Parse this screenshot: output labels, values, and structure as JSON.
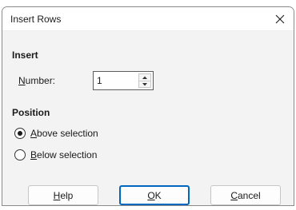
{
  "dialog": {
    "title": "Insert Rows",
    "close_icon": "close-icon"
  },
  "insert": {
    "section_title": "Insert",
    "number_label_mnemonic": "N",
    "number_label_rest": "umber:",
    "number_value": "1"
  },
  "position": {
    "section_title": "Position",
    "options": [
      {
        "mnemonic": "A",
        "rest": "bove selection",
        "selected": true
      },
      {
        "mnemonic": "B",
        "rest": "elow selection",
        "selected": false
      }
    ]
  },
  "buttons": {
    "help_mnemonic": "H",
    "help_rest": "elp",
    "ok_mnemonic": "O",
    "ok_rest": "K",
    "cancel_mnemonic": "C",
    "cancel_rest": "ancel"
  },
  "colors": {
    "default_button_border": "#0067c0",
    "dialog_background": "#f3f3f3"
  }
}
